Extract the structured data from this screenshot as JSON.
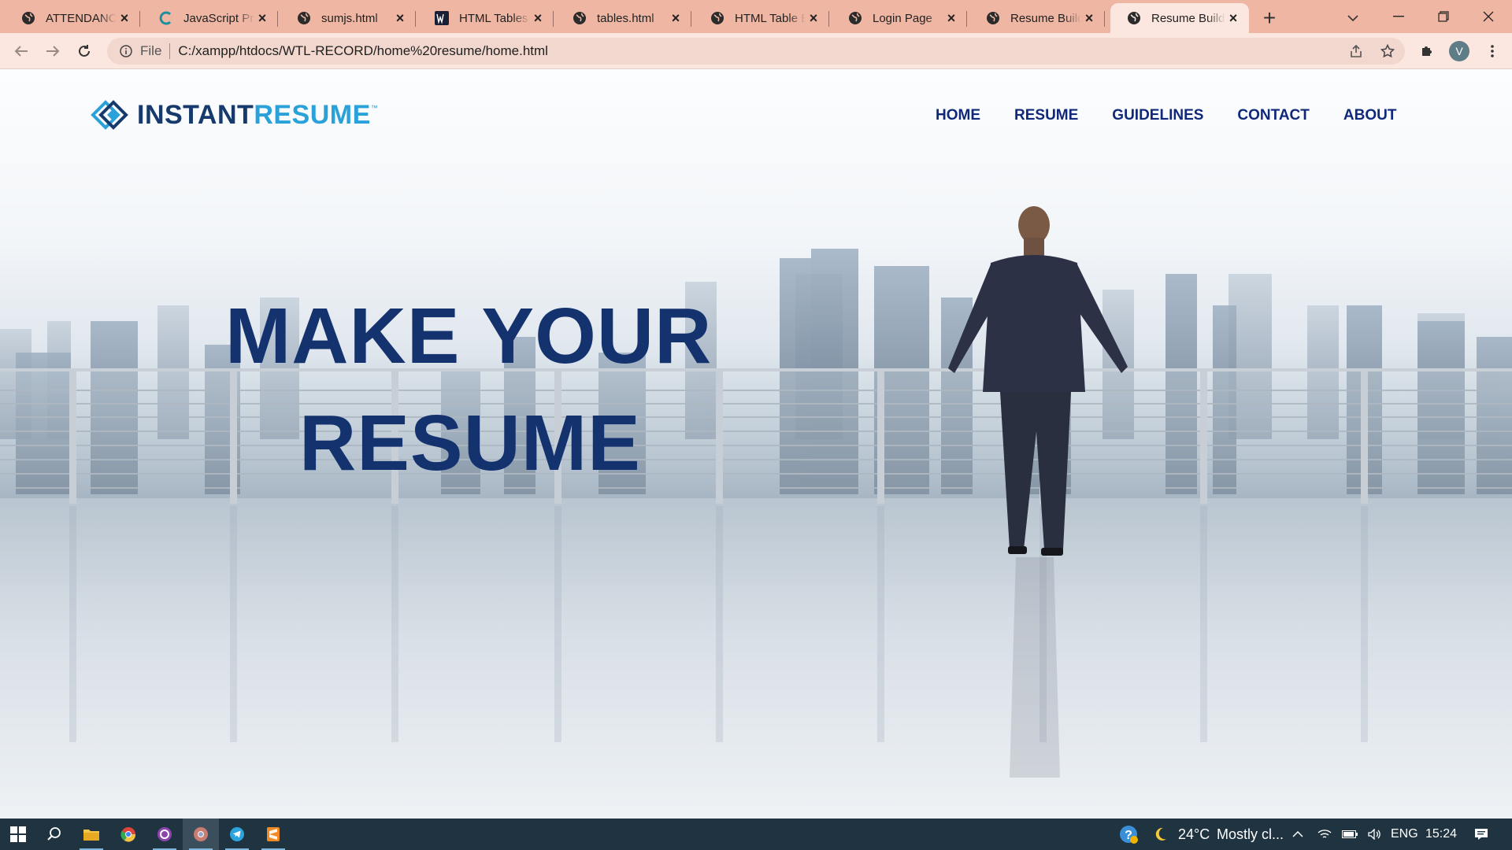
{
  "browser": {
    "tabs": [
      {
        "title": "ATTENDANCE",
        "icon": "globe-icon",
        "active": false
      },
      {
        "title": "JavaScript Program",
        "icon": "c-brand-icon",
        "active": false
      },
      {
        "title": "sumjs.html",
        "icon": "globe-icon",
        "active": false
      },
      {
        "title": "HTML Tables - ",
        "icon": "w3-brand-icon",
        "active": false
      },
      {
        "title": "tables.html",
        "icon": "globe-icon",
        "active": false
      },
      {
        "title": "HTML Table Border",
        "icon": "globe-icon",
        "active": false
      },
      {
        "title": "Login Page",
        "icon": "globe-icon",
        "active": false
      },
      {
        "title": "Resume Builder",
        "icon": "globe-icon",
        "active": false
      },
      {
        "title": "Resume Builder",
        "icon": "globe-icon",
        "active": true
      }
    ],
    "address": {
      "scheme": "File",
      "url": "C:/xampp/htdocs/WTL-RECORD/home%20resume/home.html"
    },
    "profile_initial": "V"
  },
  "site": {
    "logo": {
      "word1": "INSTANT",
      "word2": "RESUME",
      "tm": "™"
    },
    "nav": [
      "HOME",
      "RESUME",
      "GUIDELINES",
      "CONTACT",
      "ABOUT"
    ],
    "hero": {
      "line1": "MAKE YOUR",
      "line2": "RESUME"
    }
  },
  "taskbar": {
    "weather": {
      "temp": "24°C",
      "desc": "Mostly cl..."
    },
    "language": "ENG",
    "time": "15:24"
  },
  "colors": {
    "tab_strip": "#efb7a3",
    "toolbar": "#fbe7df",
    "brand_navy": "#163a6b",
    "brand_blue": "#2aa1d8",
    "nav_text": "#10287a",
    "taskbar": "#1f3340"
  }
}
